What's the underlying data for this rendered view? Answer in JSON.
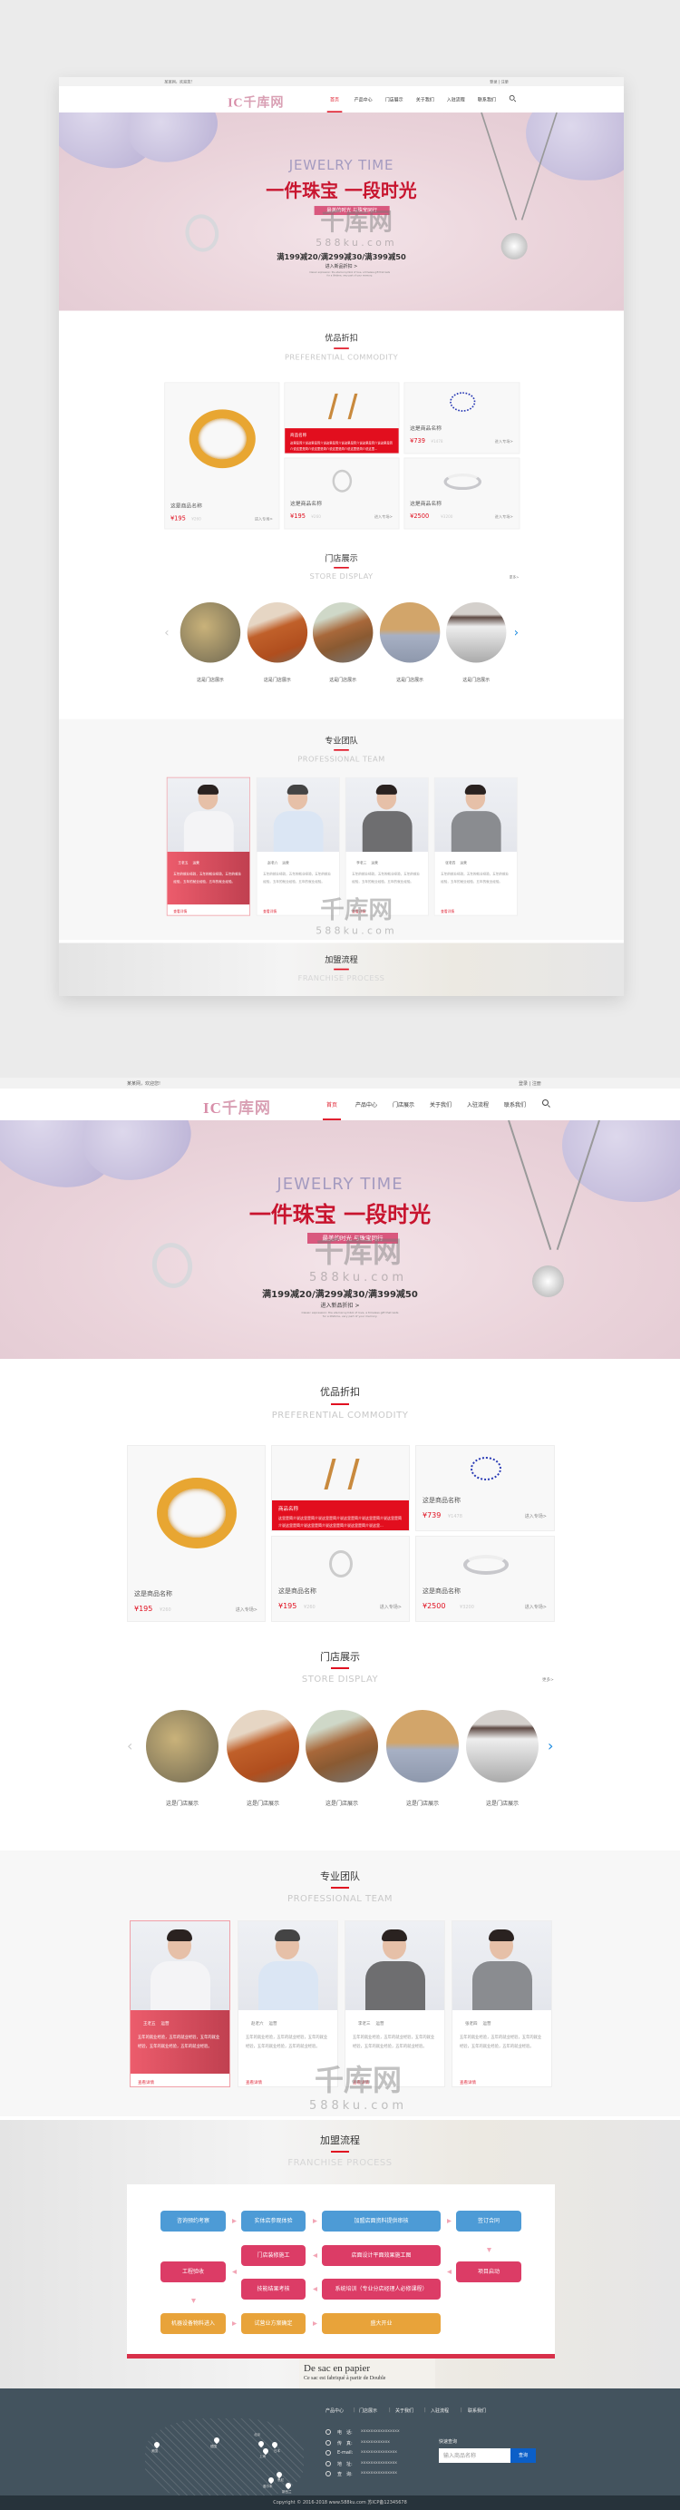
{
  "topbar": {
    "welcome": "某某网，欢迎您!",
    "auth": "登录 | 注册"
  },
  "logo": {
    "text": "千库网",
    "mark": "IC"
  },
  "nav": {
    "items": [
      "首页",
      "产品中心",
      "门店展示",
      "关于我们",
      "入驻流程",
      "联系我们"
    ],
    "active": 0,
    "search_icon": "search-icon"
  },
  "hero": {
    "title_en": "JEWELRY TIME",
    "title_cn": "一件珠宝 一段时光",
    "tag": "最美的时光 与珠宝同行",
    "promo": "满199减20/满299减30/满399减50",
    "cta": "进入新品折扣 >",
    "fine_print": "Classic expression: the eternal symbol of love, a timeless gift that lasts for a lifetime, very part of your memory."
  },
  "preferential": {
    "title": "优品折扣",
    "subtitle": "PREFERENTIAL COMMODITY",
    "featured": {
      "name": "商品名称",
      "desc": "这里是简介说这里是简介说这里是简介说这里是简介说这里是简介说这里是简介说这里是简介说这里是简介说这里是简介说这里是简介说这里..."
    },
    "products": [
      {
        "name": "这是商品名称",
        "price": "¥195",
        "old": "¥260",
        "link": "进入专场>"
      },
      {
        "name": "这是商品名称",
        "price": "¥739",
        "old": "¥1478",
        "link": "进入专场>"
      },
      {
        "name": "这是商品名称",
        "price": "¥195",
        "old": "¥260",
        "link": "进入专场>"
      },
      {
        "name": "这是商品名称",
        "price": "¥2500",
        "old": "¥3200",
        "link": "进入专场>"
      }
    ]
  },
  "stores": {
    "title": "门店展示",
    "subtitle": "STORE DISPLAY",
    "more": "更多>",
    "items": [
      "这是门店展示",
      "这是门店展示",
      "这是门店展示",
      "这是门店展示",
      "这是门店展示"
    ]
  },
  "team": {
    "title": "专业团队",
    "subtitle": "PROFESSIONAL TEAM",
    "members": [
      {
        "name": "王老五",
        "role": "运营",
        "desc": "五年的就业经验，五年的就业经验，五年的就业经验，五年的就业经验，五年的就业经验。",
        "link": "查看详情"
      },
      {
        "name": "赵老六",
        "role": "运营",
        "desc": "五年的就业经验，五年的就业经验，五年的就业经验，五年的就业经验，五年的就业经验。",
        "link": "查看详情"
      },
      {
        "name": "李老三",
        "role": "运营",
        "desc": "五年的就业经验，五年的就业经验，五年的就业经验，五年的就业经验，五年的就业经验。",
        "link": "查看详情"
      },
      {
        "name": "张老四",
        "role": "运营",
        "desc": "五年的就业经验，五年的就业经验，五年的就业经验，五年的就业经验，五年的就业经验。",
        "link": "查看详情"
      }
    ]
  },
  "franchise": {
    "title": "加盟流程",
    "subtitle": "FRANCHISE PROCESS",
    "steps": [
      "咨询预约考察",
      "实体店参观体验",
      "加盟店面资料提供审核",
      "签订合同",
      "门店装修施工",
      "店面设计平面效果施工图",
      "工程验收",
      "项目启动",
      "技能结果考核",
      "系统培训（专业分店经理人必修课程）",
      "机器设备物料进入",
      "试营业方案确定",
      "盛大开业"
    ],
    "colors": {
      "stage1": "#4d9bd6",
      "stage2": "#dc3c66",
      "stage3": "#e8a33a"
    },
    "bg_text": [
      "De sac en papier",
      "Ce sac est fabriqué à partir de Double"
    ]
  },
  "footer": {
    "links": [
      "产品中心",
      "门店展示",
      "关于我们",
      "入驻流程",
      "联系我们"
    ],
    "contacts": [
      {
        "icon": "phone-icon",
        "label": "电　话:",
        "value": "xxxxxxxxxxxxxxxx"
      },
      {
        "icon": "fax-icon",
        "label": "传　真:",
        "value": "xxxxxxxxxxxx"
      },
      {
        "icon": "mail-icon",
        "label": "E-mail:",
        "value": "xxxxxxxxxxxxxxx"
      },
      {
        "icon": "location-icon",
        "label": "地　址:",
        "value": "xxxxxxxxxxxxxxx"
      },
      {
        "icon": "search-icon",
        "label": "查　询:",
        "value": "xxxxxxxxxxxxxxx"
      }
    ],
    "map_pins": [
      "美国",
      "德国",
      "北京",
      "日本",
      "上海",
      "悉尼",
      "墨尔本",
      "新西兰"
    ],
    "quick_search": {
      "label": "快速查询",
      "placeholder": "输入商品名称",
      "button": "查询"
    },
    "copyright": "Copyright © 2016-2018  www.588ku.com  苏ICP备12345678"
  },
  "watermark": {
    "brand": "千库网",
    "url": "588ku.com"
  },
  "colors": {
    "accent": "#e01020",
    "footer": "#43535e",
    "blue": "#4d9bd6",
    "hero_pink": "#d9587e"
  }
}
